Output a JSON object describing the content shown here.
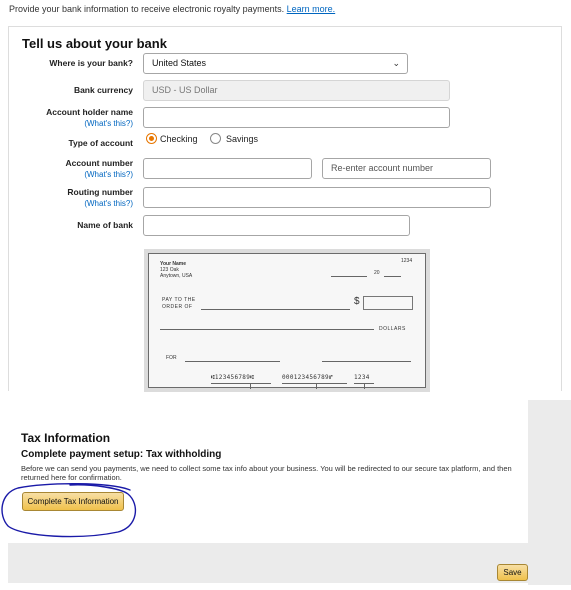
{
  "intro": {
    "text": "Provide your bank information to receive electronic royalty payments.",
    "link": "Learn more."
  },
  "bank": {
    "title": "Tell us about your bank",
    "where_label": "Where is your bank?",
    "where_value": "United States",
    "currency_label": "Bank currency",
    "currency_value": "USD - US Dollar",
    "holder_label": "Account holder name",
    "help_link": "(What's this?)",
    "type_label": "Type of account",
    "type_checking": "Checking",
    "type_savings": "Savings",
    "type_selected": "Checking",
    "account_number_label": "Account number",
    "reenter_placeholder": "Re-enter account number",
    "routing_label": "Routing number",
    "bank_name_label": "Name of bank"
  },
  "check": {
    "name": "Your Name",
    "addr1": "123 Oak",
    "addr2": "Anytown, USA",
    "number": "1234",
    "date_suffix": "20",
    "pay_line1": "PAY TO THE",
    "pay_line2": "ORDER OF",
    "dollar_sign": "$",
    "dollars": "DOLLARS",
    "for": "FOR",
    "micr_routing": "⑆123456789⑆",
    "micr_account": "000123456789⑈",
    "micr_check": "1234"
  },
  "tax": {
    "title": "Tax Information",
    "subtitle": "Complete payment setup: Tax withholding",
    "description": "Before we can send you payments, we need to collect some tax info about your business. You will be redirected to our secure tax platform, and then returned here for confirmation.",
    "button": "Complete Tax Information"
  },
  "footer": {
    "save": "Save"
  },
  "colors": {
    "accent": "#e77600",
    "link": "#0066c0",
    "button": "#f0c14b",
    "scribble": "#1a1aa8"
  }
}
